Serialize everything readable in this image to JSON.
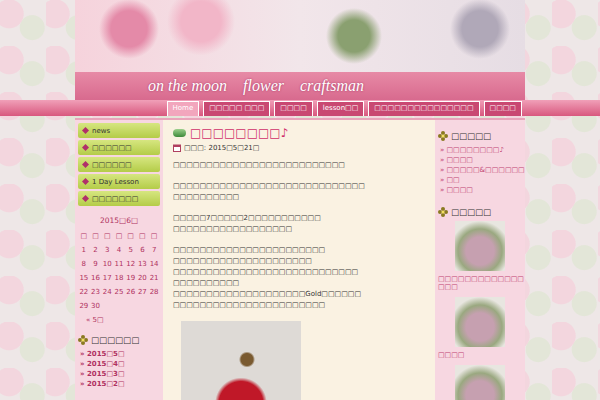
{
  "header": {
    "title": "on the moon　flower　craftsman",
    "nav": [
      {
        "label": "Home",
        "selected": true
      },
      {
        "label": "□□□□□ □□□",
        "selected": false
      },
      {
        "label": "□□□□",
        "selected": false
      },
      {
        "label": "lesson□□",
        "selected": false
      },
      {
        "label": "□□□□□□□□□□□□□□□",
        "selected": false
      },
      {
        "label": "□□□□",
        "selected": false
      }
    ]
  },
  "left": {
    "menu": [
      "news",
      "□□□□□□",
      "□□□□□□",
      "1 Day Lesson",
      "□□□□□□□"
    ],
    "calendar": {
      "caption": "2015□6□",
      "weekdays": [
        "□",
        "□",
        "□",
        "□",
        "□",
        "□",
        "□"
      ],
      "weeks": [
        [
          "1",
          "2",
          "3",
          "4",
          "5",
          "6",
          "7"
        ],
        [
          "8",
          "9",
          "10",
          "11",
          "12",
          "13",
          "14"
        ],
        [
          "15",
          "16",
          "17",
          "18",
          "19",
          "20",
          "21"
        ],
        [
          "22",
          "23",
          "24",
          "25",
          "26",
          "27",
          "28"
        ],
        [
          "29",
          "30",
          "",
          "",
          "",
          "",
          ""
        ]
      ],
      "prev": "« 5□"
    },
    "archive": {
      "title": "□□□□□□",
      "items": [
        "2015□5□",
        "2015□4□",
        "2015□3□",
        "2015□2□"
      ]
    }
  },
  "post": {
    "title": "□□□□□□□□♪",
    "date_label": "□□□:",
    "date": "2015□5□21□",
    "paragraphs": [
      [
        "□□□□□□□□□□□□□□□□□□□□□□□□□□"
      ],
      [
        "□□□□□□□□□□□□□□□□□□□□□□□□□□□□□",
        "□□□□□□□□□□"
      ],
      [
        "□□□□□7□□□□□2□□□□□□□□□□□",
        "□□□□□□□□□□□□□□□□□□"
      ],
      [
        "□□□□□□□□□□□□□□□□□□□□□□□",
        "□□□□□□□□□□□□□□□□□□□□□",
        "□□□□□□□□□□□□□□□□□□□□□□□□□□□□",
        "□□□□□□□□□□",
        "□□□□□□□□□□□□□□□□□□□□Gold□□□□□□",
        "□□□□□□□□□□□□□□□□□□□□□□□"
      ]
    ]
  },
  "right": {
    "recent": {
      "title": "□□□□□",
      "items": [
        "□□□□□□□□♪",
        "□□□□",
        "□□□□□&□□□□□□",
        "□□",
        "□□□□"
      ]
    },
    "gallery": {
      "title": "□□□□□",
      "items": [
        {
          "caption": "□□□□□□□□□□□□□ □□□"
        },
        {
          "caption": "□□□□"
        },
        {
          "caption": ""
        }
      ]
    }
  }
}
